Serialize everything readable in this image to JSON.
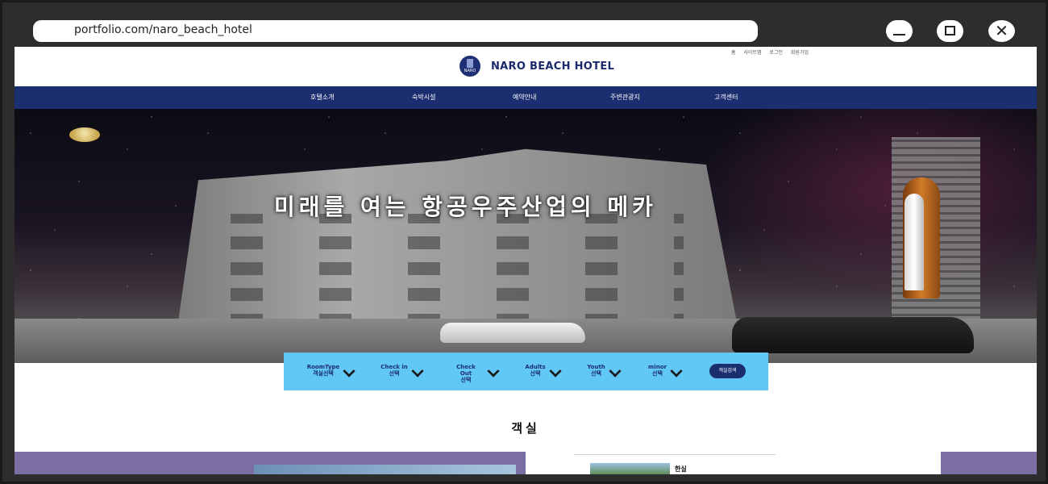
{
  "browser": {
    "url": "portfolio.com/naro_beach_hotel"
  },
  "header": {
    "util_links": [
      "홈",
      "사이트맵",
      "로그인",
      "회원가입"
    ],
    "logo_text": "NARO",
    "hotel_name": "NARO BEACH HOTEL"
  },
  "nav": {
    "items": [
      "호텔소개",
      "숙박시설",
      "예약안내",
      "주변관광지",
      "고객센터"
    ]
  },
  "hero": {
    "headline": "미래를 여는 항공우주산업의 메카"
  },
  "search": {
    "fields": [
      {
        "label": "RoomType",
        "value": "객실선택"
      },
      {
        "label": "Check in",
        "value": "선택"
      },
      {
        "label": "Check Out",
        "value": "선택"
      },
      {
        "label": "Adults",
        "value": "선택"
      },
      {
        "label": "Youth",
        "value": "선택"
      },
      {
        "label": "minor",
        "value": "선택"
      }
    ],
    "button": "객실검색"
  },
  "rooms": {
    "title": "객실",
    "card_label": "한실"
  },
  "colors": {
    "nav_bg": "#1b2f70",
    "search_bg": "#61c7f5",
    "bottom_panel": "#7a6ea3"
  }
}
